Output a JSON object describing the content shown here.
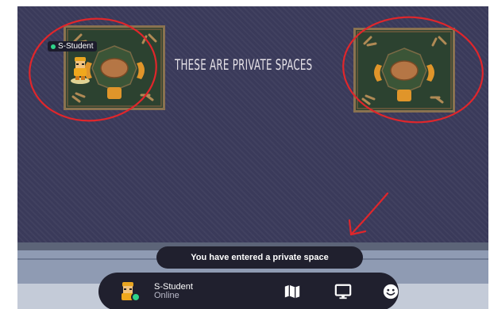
{
  "map": {
    "label": "THESE ARE PRIVATE SPACES",
    "player_name": "S-Student"
  },
  "notification": {
    "text": "You have entered a private space"
  },
  "toolbar": {
    "user_name": "S-Student",
    "user_status": "Online",
    "icons": [
      "avatar-icon",
      "map-icon",
      "screen-share-icon",
      "emoji-icon"
    ]
  },
  "colors": {
    "floor": "#3a3a5a",
    "annotation": "#e0262b",
    "online": "#2fd38a",
    "toolbar_bg": "#20202e"
  }
}
